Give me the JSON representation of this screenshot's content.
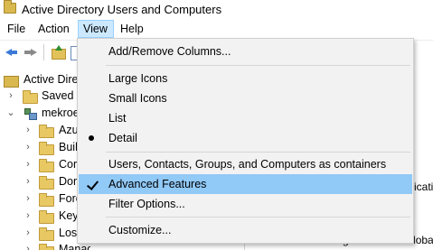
{
  "window": {
    "title": "Active Directory Users and Computers"
  },
  "menubar": {
    "file": "File",
    "action": "Action",
    "view": "View",
    "help": "Help"
  },
  "tree": {
    "root": "Active Directory Users and Computers",
    "saved": "Saved Q",
    "domain": "mekroe",
    "items": [
      "Azu",
      "Buil",
      "Cor",
      "Dor",
      "Fore",
      "Key",
      "Los",
      "Managed Service Accounts"
    ]
  },
  "right_pane": {
    "text1": "ication",
    "text2": "DFSR-GlobalSettings  msDFSR-GlobalSettings  DFS Replication"
  },
  "view_menu": {
    "add_remove_columns": "Add/Remove Columns...",
    "large_icons": "Large Icons",
    "small_icons": "Small Icons",
    "list": "List",
    "detail": "Detail",
    "containers": "Users, Contacts, Groups, and Computers as containers",
    "advanced_features": "Advanced Features",
    "filter_options": "Filter Options...",
    "customize": "Customize..."
  }
}
